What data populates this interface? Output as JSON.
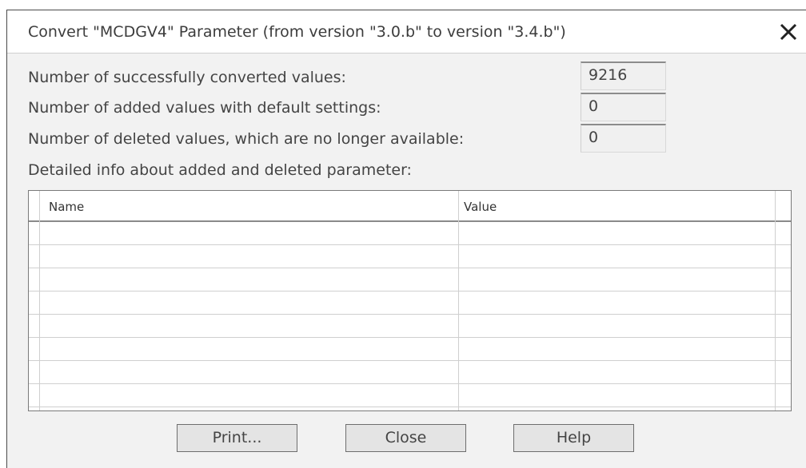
{
  "dialog": {
    "title": "Convert \"MCDGV4\" Parameter (from version \"3.0.b\" to version \"3.4.b\")",
    "close_icon": "close-icon"
  },
  "stats": [
    {
      "label": "Number of successfully converted values:",
      "value": "9216"
    },
    {
      "label": "Number of added values with default settings:",
      "value": "0"
    },
    {
      "label": "Number of deleted values, which are no longer available:",
      "value": "0"
    }
  ],
  "detail_label": "Detailed info about added and deleted parameter:",
  "table": {
    "columns": [
      "Name",
      "Value"
    ],
    "rows": []
  },
  "buttons": {
    "print": "Print...",
    "close": "Close",
    "help": "Help"
  }
}
